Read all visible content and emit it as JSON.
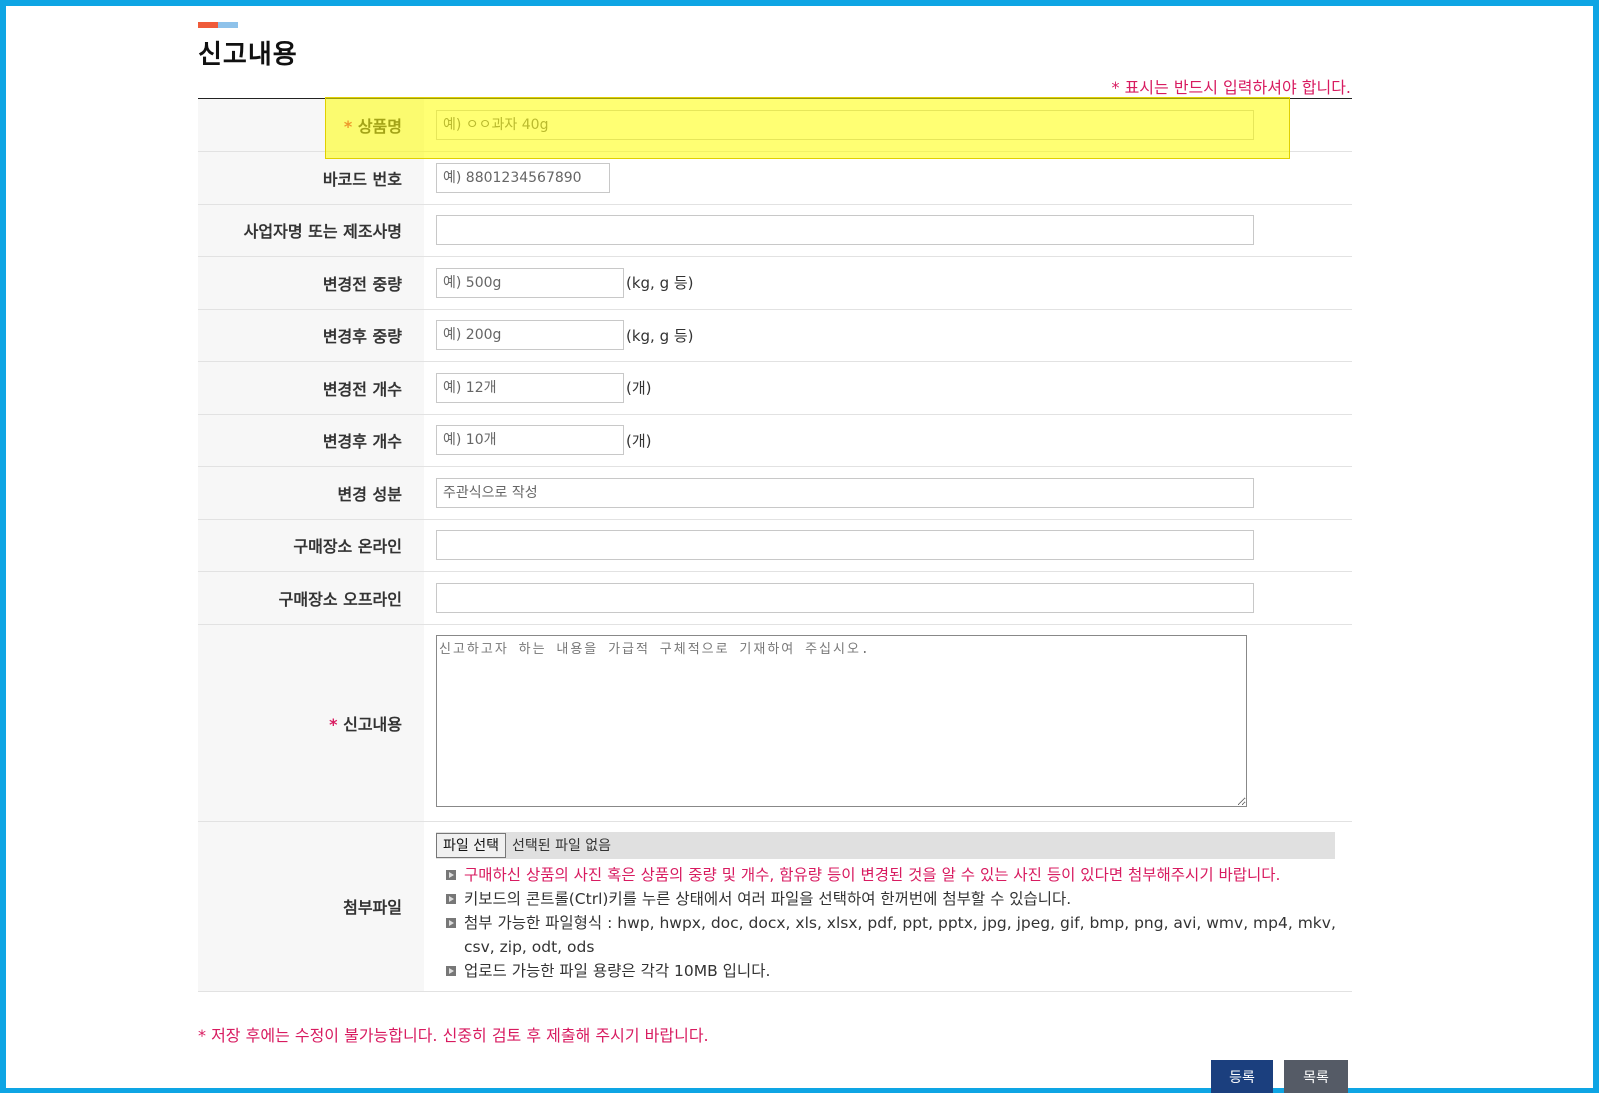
{
  "section_title": "신고내용",
  "required_note": "* 표시는 반드시 입력하셔야 합니다.",
  "required_mark": "*",
  "fields": {
    "product_name": {
      "label": "상품명",
      "placeholder": "예) ㅇㅇ과자 40g"
    },
    "barcode": {
      "label": "바코드 번호",
      "placeholder": "예) 8801234567890"
    },
    "maker": {
      "label": "사업자명 또는 제조사명",
      "placeholder": ""
    },
    "weight_before": {
      "label": "변경전 중량",
      "placeholder": "예) 500g",
      "unit": "(kg, g 등)"
    },
    "weight_after": {
      "label": "변경후 중량",
      "placeholder": "예) 200g",
      "unit": "(kg, g 등)"
    },
    "count_before": {
      "label": "변경전 개수",
      "placeholder": "예) 12개",
      "unit": "(개)"
    },
    "count_after": {
      "label": "변경후 개수",
      "placeholder": "예) 10개",
      "unit": "(개)"
    },
    "ingredients": {
      "label": "변경 성분",
      "placeholder": "주관식으로 작성"
    },
    "store_online": {
      "label": "구매장소 온라인",
      "placeholder": ""
    },
    "store_offline": {
      "label": "구매장소 오프라인",
      "placeholder": ""
    },
    "report_content": {
      "label": "신고내용",
      "placeholder": "신고하고자 하는 내용을 가급적 구체적으로 기재하여 주십시오."
    },
    "attachment": {
      "label": "첨부파일",
      "button": "파일 선택",
      "status": "선택된 파일 없음",
      "notes": [
        "구매하신 상품의 사진 혹은 상품의 중량 및 개수, 함유량 등이 변경된 것을 알 수 있는 사진 등이 있다면 첨부해주시기 바랍니다.",
        "키보드의 콘트롤(Ctrl)키를 누른 상태에서 여러 파일을 선택하여 한꺼번에 첨부할 수 있습니다.",
        "첨부 가능한 파일형식 : hwp, hwpx, doc, docx, xls, xlsx, pdf, ppt, pptx, jpg, jpeg, gif, bmp, png, avi, wmv, mp4, mkv, csv, zip, odt, ods",
        "업로드 가능한 파일 용량은 각각 10MB 입니다."
      ]
    }
  },
  "bottom_note": "* 저장 후에는 수정이 불가능합니다. 신중히 검토 후 제출해 주시기 바랍니다.",
  "buttons": {
    "submit": "등록",
    "list": "목록"
  },
  "colors": {
    "accent_red": "#d81b60",
    "submit_bg": "#1b3f7e",
    "list_bg": "#555b66",
    "frame": "#0ea5e4",
    "highlight": "#ffff66"
  }
}
